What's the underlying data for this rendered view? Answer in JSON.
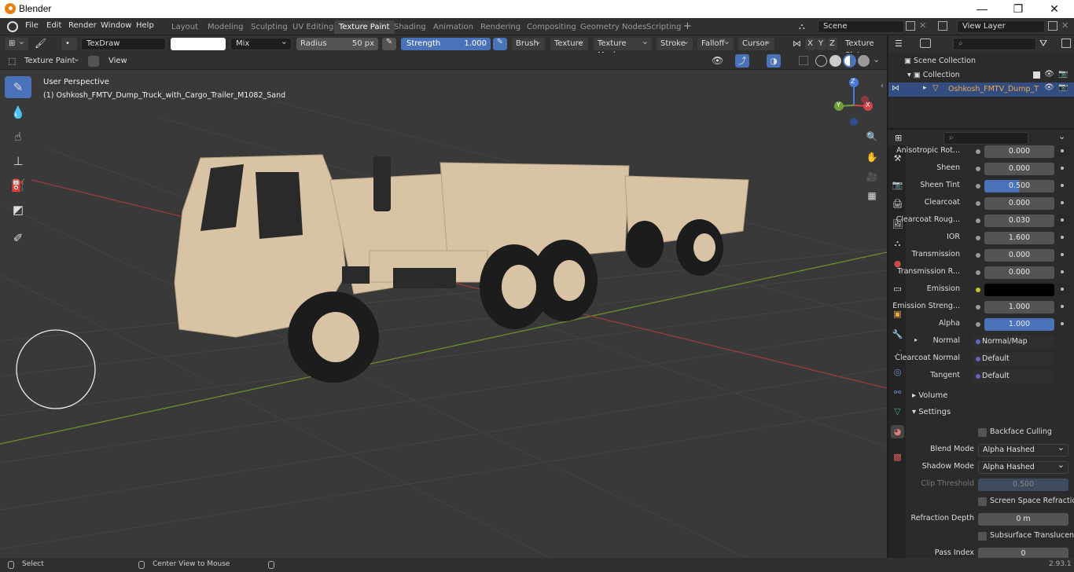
{
  "window": {
    "title": "Blender",
    "minimize": "—",
    "maximize": "❐",
    "close": "✕"
  },
  "menu": {
    "file": "File",
    "edit": "Edit",
    "render": "Render",
    "window": "Window",
    "help": "Help"
  },
  "workspaces": [
    "Layout",
    "Modeling",
    "Sculpting",
    "UV Editing",
    "Texture Paint",
    "Shading",
    "Animation",
    "Rendering",
    "Compositing",
    "Geometry Nodes",
    "Scripting"
  ],
  "active_workspace": "Texture Paint",
  "scene": {
    "label": "Scene",
    "view_layer": "View Layer"
  },
  "toolheader": {
    "brush_name": "TexDraw",
    "blend": "Mix",
    "radius_label": "Radius",
    "radius_value": "50 px",
    "strength_label": "Strength",
    "strength_value": "1.000",
    "brush": "Brush",
    "texture": "Texture",
    "texture_mask": "Texture Mask",
    "stroke": "Stroke",
    "falloff": "Falloff",
    "cursor": "Cursor",
    "x": "X",
    "y": "Y",
    "z": "Z",
    "texture_slots": "Texture Slots"
  },
  "viewheader": {
    "mode": "Texture Paint",
    "view": "View"
  },
  "viewport": {
    "perspective": "User Perspective",
    "object": "(1) Oshkosh_FMTV_Dump_Truck_with_Cargo_Trailer_M1082_Sand",
    "gizmo": {
      "x": "X",
      "y": "Y",
      "z": "Z"
    }
  },
  "outliner": {
    "scene_collection": "Scene Collection",
    "collection": "Collection",
    "object": "Oshkosh_FMTV_Dump_T"
  },
  "properties": {
    "rows": [
      {
        "label": "Anisotropic Rot...",
        "value": "0.000",
        "type": "num"
      },
      {
        "label": "Sheen",
        "value": "0.000",
        "type": "num"
      },
      {
        "label": "Sheen Tint",
        "value": "0.500",
        "type": "bar",
        "fill": 0.5
      },
      {
        "label": "Clearcoat",
        "value": "0.000",
        "type": "num"
      },
      {
        "label": "Clearcoat Roug...",
        "value": "0.030",
        "type": "num"
      },
      {
        "label": "IOR",
        "value": "1.600",
        "type": "num"
      },
      {
        "label": "Transmission",
        "value": "0.000",
        "type": "num"
      },
      {
        "label": "Transmission R...",
        "value": "0.000",
        "type": "num"
      },
      {
        "label": "Emission",
        "value": "",
        "type": "color"
      },
      {
        "label": "Emission Streng...",
        "value": "1.000",
        "type": "num"
      },
      {
        "label": "Alpha",
        "value": "1.000",
        "type": "bar",
        "fill": 1.0
      },
      {
        "label": "Normal",
        "value": "Normal/Map",
        "type": "link"
      },
      {
        "label": "Clearcoat Normal",
        "value": "Default",
        "type": "link"
      },
      {
        "label": "Tangent",
        "value": "Default",
        "type": "link"
      }
    ],
    "volume": "Volume",
    "settings": "Settings",
    "backface_culling": "Backface Culling",
    "blend_mode_label": "Blend Mode",
    "blend_mode": "Alpha Hashed",
    "shadow_mode_label": "Shadow Mode",
    "shadow_mode": "Alpha Hashed",
    "clip_threshold_label": "Clip Threshold",
    "clip_threshold": "0.500",
    "ssr": "Screen Space Refraction",
    "refraction_depth_label": "Refraction Depth",
    "refraction_depth": "0 m",
    "subsurface": "Subsurface Translucency",
    "pass_index_label": "Pass Index",
    "pass_index": "0"
  },
  "status": {
    "select": "Select",
    "center": "Center View to Mouse",
    "version": "2.93.1"
  },
  "colors": {
    "accent": "#4a72b8",
    "active_object": "#e8a84a",
    "truck": "#d9c3a5"
  }
}
